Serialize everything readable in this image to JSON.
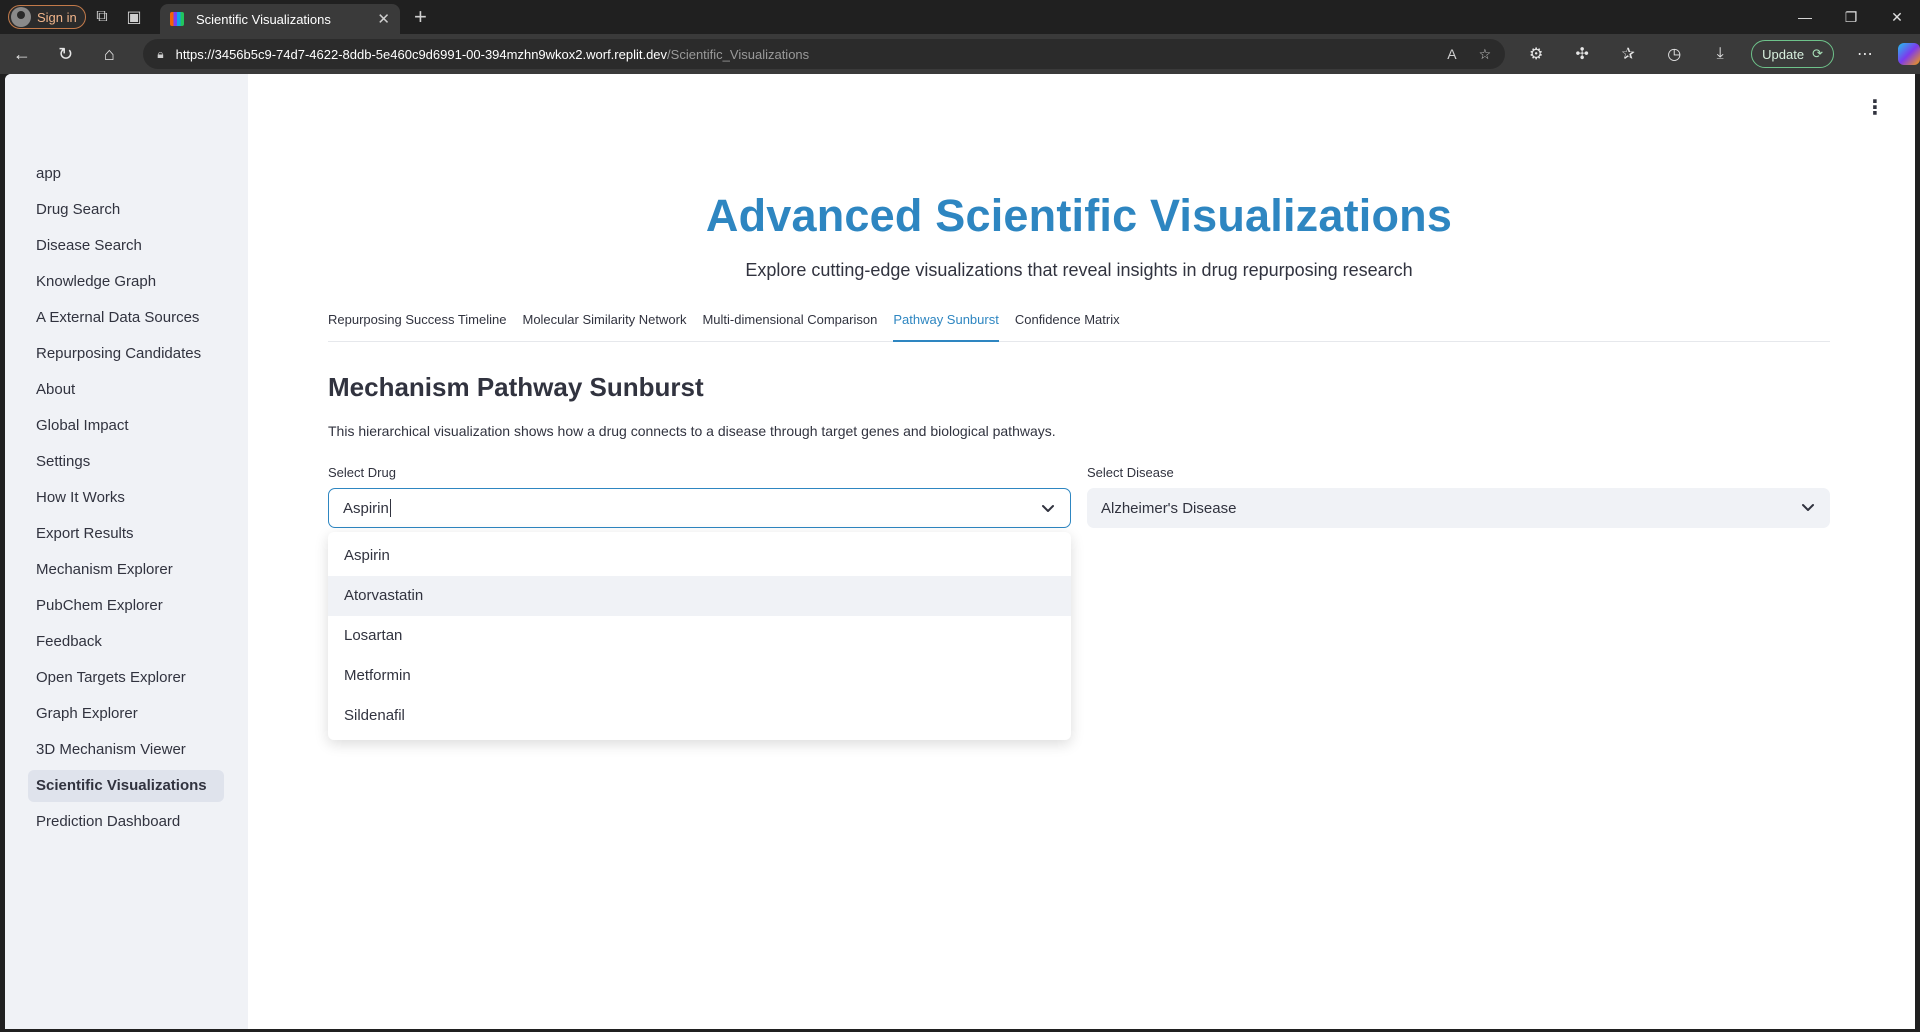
{
  "browser": {
    "signin_label": "Sign in",
    "tab_title": "Scientific Visualizations",
    "url_host": "https://3456b5c9-74d7-4622-8ddb-5e460c9d6991-00-394mzhn9wkox2.worf.replit.dev",
    "url_path": "/Scientific_Visualizations",
    "update_label": "Update"
  },
  "sidebar": {
    "items": [
      {
        "label": "app"
      },
      {
        "label": "Drug Search"
      },
      {
        "label": "Disease Search"
      },
      {
        "label": "Knowledge Graph"
      },
      {
        "label": "A External Data Sources"
      },
      {
        "label": "Repurposing Candidates"
      },
      {
        "label": "About"
      },
      {
        "label": "Global Impact"
      },
      {
        "label": "Settings"
      },
      {
        "label": "How It Works"
      },
      {
        "label": "Export Results"
      },
      {
        "label": "Mechanism Explorer"
      },
      {
        "label": "PubChem Explorer"
      },
      {
        "label": "Feedback"
      },
      {
        "label": "Open Targets Explorer"
      },
      {
        "label": "Graph Explorer"
      },
      {
        "label": "3D Mechanism Viewer"
      },
      {
        "label": "Scientific Visualizations"
      },
      {
        "label": "Prediction Dashboard"
      }
    ],
    "active": "Scientific Visualizations"
  },
  "main": {
    "title": "Advanced Scientific Visualizations",
    "subtitle": "Explore cutting-edge visualizations that reveal insights in drug repurposing research",
    "tabs": [
      {
        "label": "Repurposing Success Timeline"
      },
      {
        "label": "Molecular Similarity Network"
      },
      {
        "label": "Multi-dimensional Comparison"
      },
      {
        "label": "Pathway Sunburst"
      },
      {
        "label": "Confidence Matrix"
      }
    ],
    "active_tab": "Pathway Sunburst",
    "section_title": "Mechanism Pathway Sunburst",
    "section_desc": "This hierarchical visualization shows how a drug connects to a disease through target genes and biological pathways.",
    "drug_select": {
      "label": "Select Drug",
      "value": "Aspirin",
      "options": [
        "Aspirin",
        "Atorvastatin",
        "Losartan",
        "Metformin",
        "Sildenafil"
      ],
      "hovered": "Atorvastatin"
    },
    "disease_select": {
      "label": "Select Disease",
      "value": "Alzheimer's Disease"
    }
  },
  "colors": {
    "accent": "#2e86c1",
    "sidebar_bg": "#f0f2f6",
    "text": "#31333f"
  }
}
